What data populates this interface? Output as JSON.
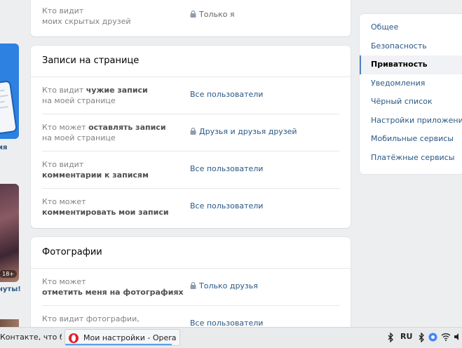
{
  "panels": {
    "top_partial": {
      "rows": [
        {
          "label_pre": "Кто видит",
          "label_strong": "моих скрытых друзей",
          "value": "Только я",
          "locked": true
        }
      ]
    },
    "posts": {
      "title": "Записи на странице",
      "rows": [
        {
          "label_pre": "Кто видит",
          "label_strong": "чужие записи",
          "label_post": "на моей странице",
          "value": "Все пользователи",
          "locked": false
        },
        {
          "label_pre": "Кто может",
          "label_strong": "оставлять записи",
          "label_post": "на моей странице",
          "value": "Друзья и друзья друзей",
          "locked": true
        },
        {
          "label_pre": "Кто видит",
          "label_strong": "комментарии к записям",
          "value": "Все пользователи",
          "locked": false
        },
        {
          "label_pre": "Кто может",
          "label_strong": "комментировать мои записи",
          "value": "Все пользователи",
          "locked": false
        }
      ]
    },
    "photos": {
      "title": "Фотографии",
      "rows": [
        {
          "label_pre": "Кто может",
          "label_strong": "отметить меня на фотографиях",
          "value": "Только друзья",
          "locked": true
        },
        {
          "label_pre": "Кто видит фотографии,",
          "value": "Все пользователи",
          "locked": false
        }
      ]
    }
  },
  "menu": {
    "items": [
      {
        "label": "Общее",
        "active": false
      },
      {
        "label": "Безопасность",
        "active": false
      },
      {
        "label": "Приватность",
        "active": true
      },
      {
        "label": "Уведомления",
        "active": false
      },
      {
        "label": "Чёрный список",
        "active": false
      },
      {
        "label": "Настройки приложений",
        "active": false
      },
      {
        "label": "Мобильные сервисы",
        "active": false
      },
      {
        "label": "Платёжные сервисы",
        "active": false
      }
    ]
  },
  "left_column": {
    "promo_text": "ия",
    "photo_text": "нуты!",
    "age_badge": "18+"
  },
  "taskbar": {
    "task1_label": "Контакте, что бы ...",
    "task2_label": "Мои настройки - Opera",
    "task2_progress": 0.93,
    "language": "RU"
  },
  "colors": {
    "link": "#2a5885",
    "active_bar": "#5181b8",
    "background": "#edeef0"
  }
}
